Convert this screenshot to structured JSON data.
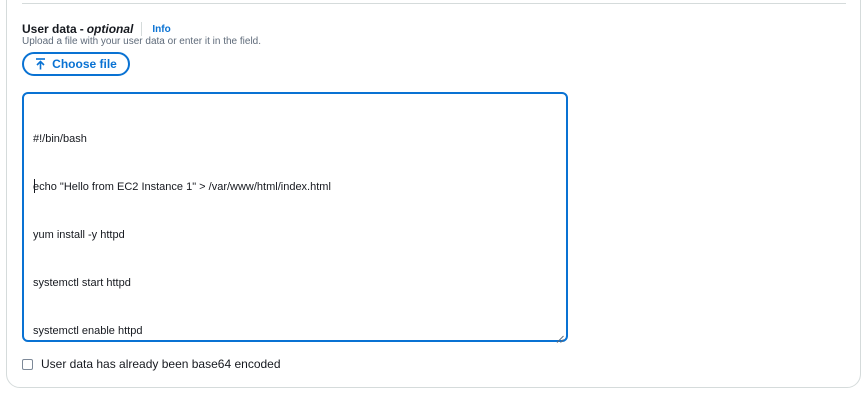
{
  "field": {
    "label": "User data",
    "separator": "-",
    "optional_label": "optional",
    "info_link": "Info",
    "description": "Upload a file with your user data or enter it in the field.",
    "choose_file_label": "Choose file",
    "upload_icon": "upload-arrow-icon"
  },
  "editor": {
    "lines": [
      "#!/bin/bash",
      "echo \"Hello from EC2 Instance 1\" > /var/www/html/index.html",
      "yum install -y httpd",
      "systemctl start httpd",
      "systemctl enable httpd"
    ],
    "focused": true
  },
  "base64_option": {
    "label": "User data has already been base64 encoded",
    "checked": false
  },
  "colors": {
    "accent": "#0972d3",
    "border": "#d5dbdb",
    "text": "#16191f",
    "muted_text": "#5f6b7a"
  }
}
